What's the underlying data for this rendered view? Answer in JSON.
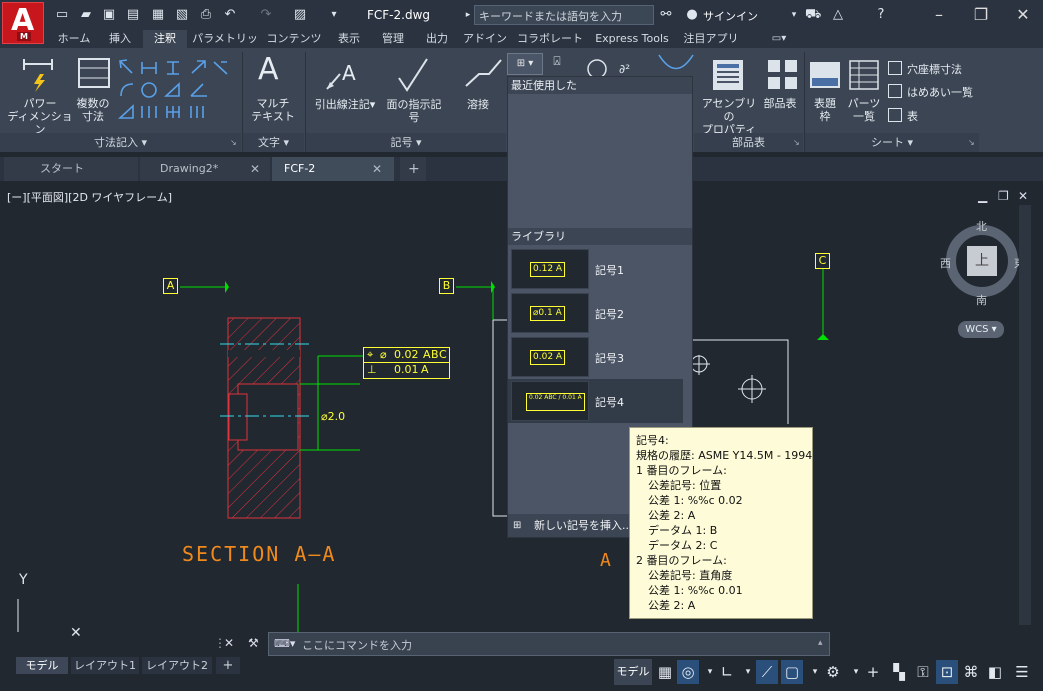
{
  "app": {
    "logo_letter": "A",
    "logo_sub": "M",
    "doc_title": "FCF-2.dwg",
    "search_placeholder": "キーワードまたは語句を入力",
    "signin_label": "サインイン"
  },
  "ribbon_tabs": [
    "ホーム",
    "挿入",
    "注釈",
    "パラメトリック",
    "コンテンツ",
    "表示",
    "管理",
    "出力",
    "アドイン",
    "コラボレート",
    "Express Tools",
    "注目アプリ"
  ],
  "ribbon_active_tab": "注釈",
  "ribbon": {
    "power_dim_label": "パワー\nディメンション",
    "multi_dim_label": "複数の\n寸法",
    "dim_panel": "寸法記入",
    "mtext_label": "マルチ\nテキスト",
    "text_panel": "文字",
    "leader_label": "引出線注記",
    "surface_label": "面の指示記\n号",
    "weld_label": "溶接",
    "symbol_panel": "記号",
    "assembly_prop_label": "アセンブリの\nプロパティ",
    "bom_label": "部品表",
    "parts_panel": "部品表",
    "title_block_label": "表題\n枠",
    "parts_list_label": "パーツ\n一覧",
    "hole_dim_label": "穴座標寸法",
    "fit_list_label": "はめあい一覧",
    "table_label": "表",
    "sheet_panel": "シート"
  },
  "doc_tabs": [
    {
      "label": "スタート",
      "closable": false
    },
    {
      "label": "Drawing2*",
      "closable": true
    },
    {
      "label": "FCF-2",
      "closable": true
    }
  ],
  "doc_tab_add": "+",
  "viewport_label": "[ー][平面図][2D ワイヤフレーム]",
  "drawing": {
    "section_title": "SECTION  A–A",
    "datum_a": "A",
    "datum_b": "B",
    "datum_c": "C",
    "fcf1_row1": "0.02",
    "fcf1_row1_refs": [
      "A",
      "B",
      "C"
    ],
    "fcf1_row2": "0.01",
    "fcf1_row2_ref": "A",
    "dia_label": "⌀2.0",
    "section_arrow": "A"
  },
  "dropdown": {
    "recent_header": "最近使用した",
    "library_header": "ライブラリ",
    "items": [
      {
        "label": "記号1",
        "thumb": "0.12 A"
      },
      {
        "label": "記号2",
        "thumb": "⌀0.1 A"
      },
      {
        "label": "記号3",
        "thumb": "0.02 A"
      },
      {
        "label": "記号4",
        "thumb": "0.02 ABC / 0.01 A"
      }
    ],
    "insert_label": "新しい記号を挿入..."
  },
  "tooltip": {
    "lines": [
      {
        "text": "記号4:",
        "indent": false
      },
      {
        "text": "規格の履歴: ASME Y14.5M - 1994",
        "indent": false
      },
      {
        "text": "1 番目のフレーム:",
        "indent": false
      },
      {
        "text": "公差記号: 位置",
        "indent": true
      },
      {
        "text": "公差 1: %%c 0.02",
        "indent": true
      },
      {
        "text": "公差 2: A",
        "indent": true
      },
      {
        "text": "データム 1: B",
        "indent": true
      },
      {
        "text": "データム 2: C",
        "indent": true
      },
      {
        "text": "2 番目のフレーム:",
        "indent": false
      },
      {
        "text": "公差記号: 直角度",
        "indent": true
      },
      {
        "text": "公差 1: %%c 0.01",
        "indent": true
      },
      {
        "text": "公差 2: A",
        "indent": true
      }
    ]
  },
  "viewcube": {
    "north": "北",
    "south": "南",
    "east": "東",
    "west": "西",
    "face": "上",
    "wcs": "WCS"
  },
  "command_placeholder": "ここにコマンドを入力",
  "layout_tabs": [
    "モデル",
    "レイアウト1",
    "レイアウト2"
  ],
  "status_model": "モデル",
  "colors": {
    "yellow": "#ffff33",
    "green": "#00e000",
    "red": "#e0333d",
    "cyan": "#33ddee",
    "orange": "#f08a1c"
  }
}
